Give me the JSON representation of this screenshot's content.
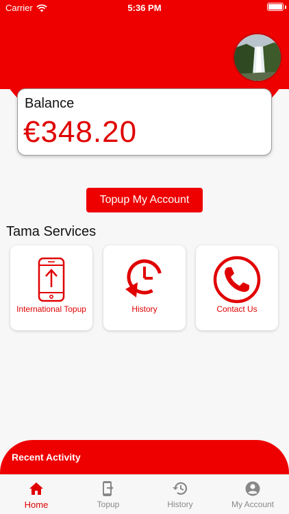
{
  "status_bar": {
    "carrier": "Carrier",
    "time": "5:36 PM",
    "battery_level": 1.0
  },
  "balance": {
    "label": "Balance",
    "value": "€348.20"
  },
  "topup_button": {
    "label": "Topup My Account"
  },
  "services": {
    "title": "Tama Services",
    "items": [
      {
        "label": "International Topup",
        "icon": "phone-upload-icon"
      },
      {
        "label": "History",
        "icon": "clock-history-icon"
      },
      {
        "label": "Contact Us",
        "icon": "phone-call-icon"
      }
    ]
  },
  "recent_activity": {
    "title": "Recent Activity"
  },
  "tab_bar": {
    "active": "Home",
    "items": [
      {
        "label": "Home",
        "icon": "home-icon"
      },
      {
        "label": "Topup",
        "icon": "mobile-topup-icon"
      },
      {
        "label": "History",
        "icon": "history-icon"
      },
      {
        "label": "My Account",
        "icon": "account-circle-icon"
      }
    ]
  },
  "colors": {
    "brand": "#ee0000",
    "background": "#f7f7f7",
    "inactive": "#888888"
  }
}
